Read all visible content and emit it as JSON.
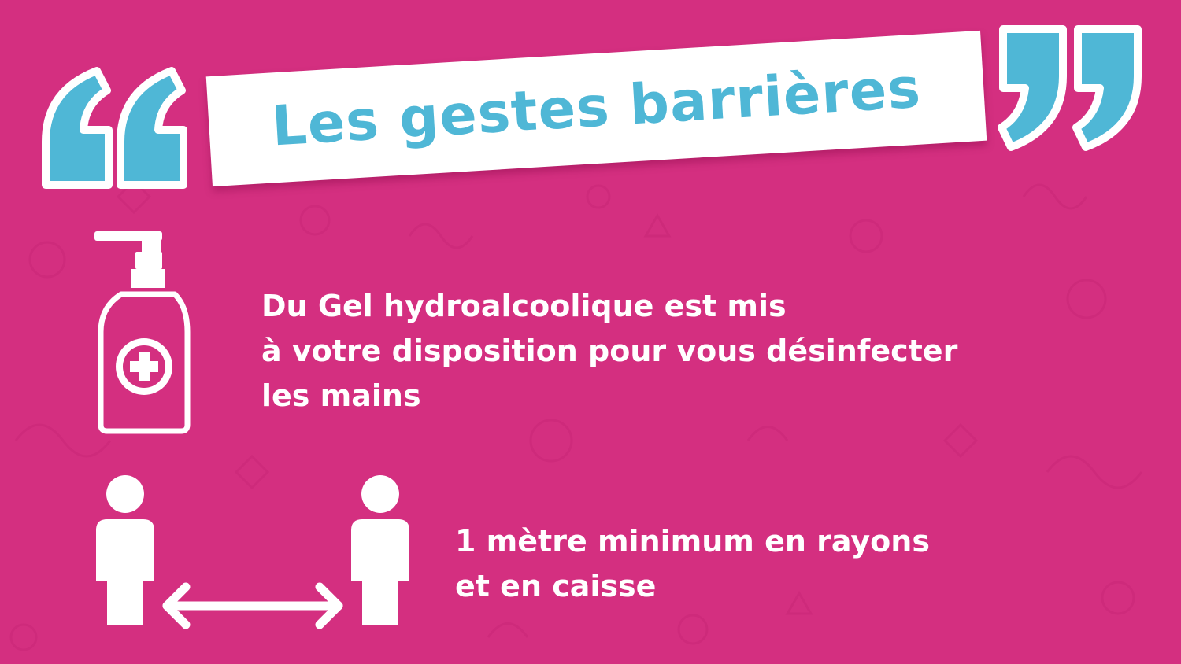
{
  "title": "Les gestes barrières",
  "gel_message": {
    "lines": [
      "Du Gel hydroalcoolique est mis",
      "à votre disposition pour vous désinfecter",
      "les mains"
    ]
  },
  "distance_message": {
    "lines": [
      "1 mètre minimum en rayons",
      "et en caisse"
    ]
  },
  "icons": {
    "open_quote": "open-quote-icon",
    "close_quote": "close-quote-icon",
    "gel": "hand-sanitizer-bottle-icon",
    "distance": "two-people-distance-icon"
  },
  "colors": {
    "background": "#d42f80",
    "accent": "#4fb7d6",
    "banner": "#ffffff",
    "text": "#ffffff"
  }
}
